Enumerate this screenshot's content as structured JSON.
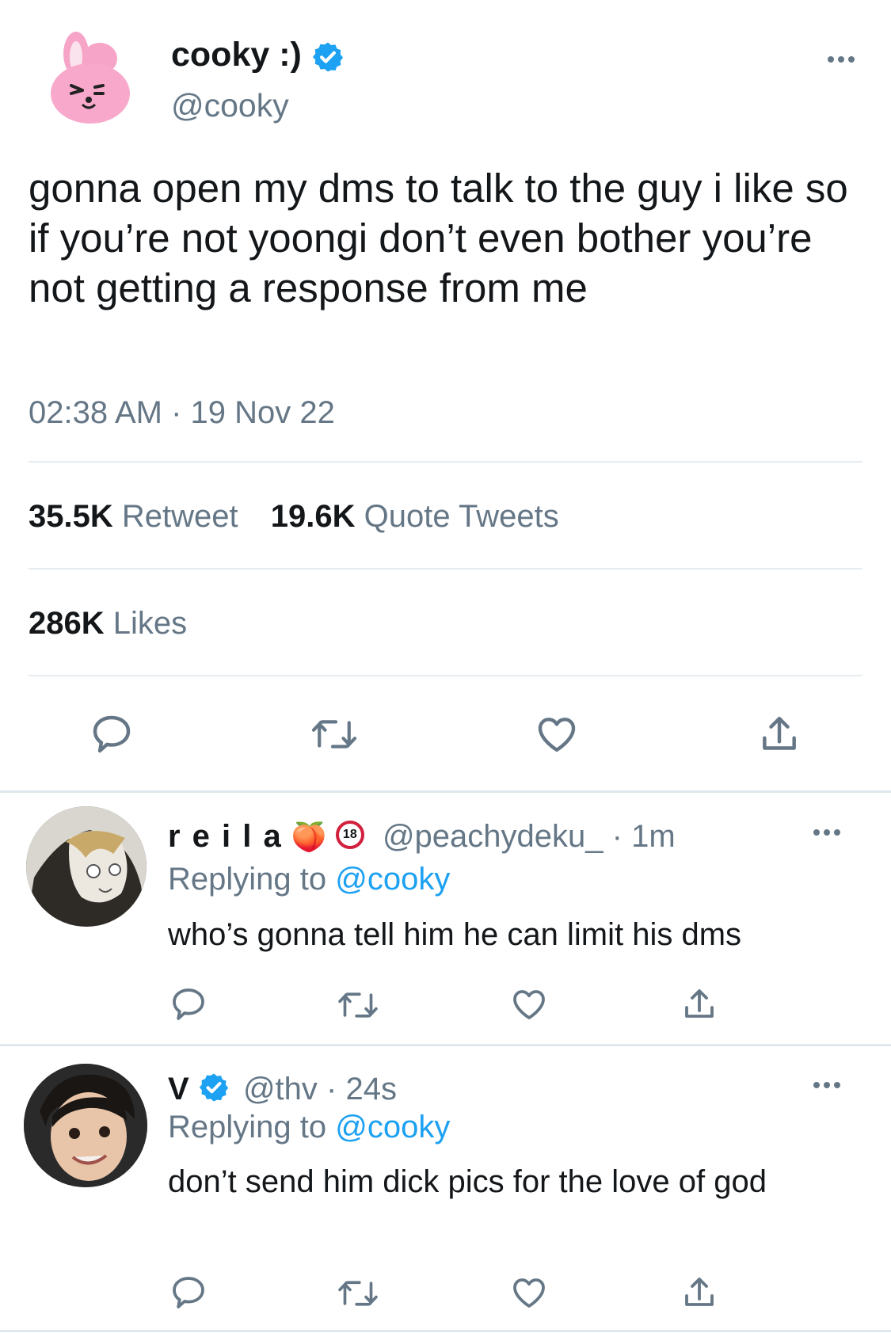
{
  "main_tweet": {
    "display_name": "cooky :)",
    "handle": "@cooky",
    "text": "gonna open my dms to talk to the guy i like so if you’re not yoongi don’t even bother you’re not getting a response from me",
    "timestamp": "02:38 AM · 19 Nov 22",
    "stats": {
      "retweet_count": "35.5K",
      "retweet_label": "Retweet",
      "quote_count": "19.6K",
      "quote_label": "Quote Tweets",
      "like_count": "286K",
      "like_label": "Likes"
    },
    "avatar_icon": "pink-bunny-avatar"
  },
  "replies": [
    {
      "display_name": "r e i l a",
      "emoji": "🍑",
      "badge": "18",
      "handle_time": "@peachydeku_ · 1m",
      "replying_label": "Replying to",
      "replying_handle": "@cooky",
      "text": "who’s gonna tell him he can limit his dms"
    },
    {
      "display_name": "V",
      "handle_time": "@thv · 24s",
      "replying_label": "Replying to",
      "replying_handle": "@cooky",
      "text": "don’t send him dick pics for the love of god"
    }
  ],
  "icons": {
    "reply": "comment-icon",
    "retweet": "retweet-icon",
    "like": "heart-icon",
    "share": "share-icon",
    "verified": "verified-badge-icon",
    "more": "more-options-icon"
  },
  "colors": {
    "link": "#1da1f2",
    "secondary": "#657786",
    "verified": "#1da1f2"
  }
}
